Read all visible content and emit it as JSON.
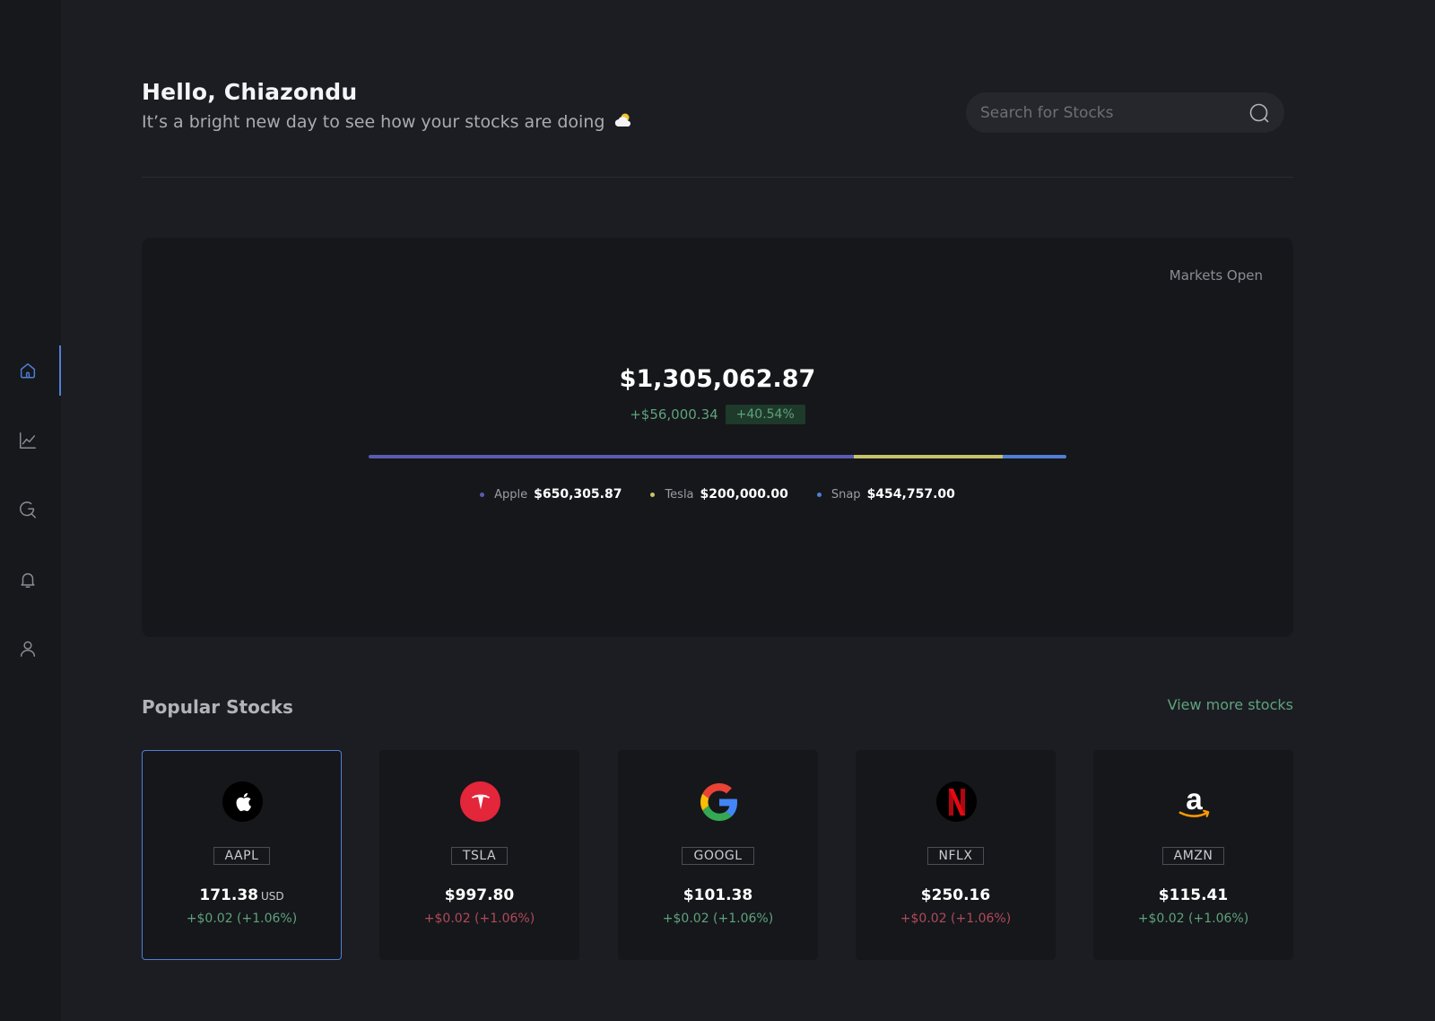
{
  "colors": {
    "accent": "#4f7fd6",
    "positive": "#5fa27d",
    "negative": "#b04a5a",
    "apple": "#5a5cb0",
    "tesla": "#c8c36a",
    "snap": "#4f7fd6"
  },
  "sidebar": {
    "items": [
      {
        "name": "home",
        "icon": "home-icon",
        "active": true
      },
      {
        "name": "charts",
        "icon": "line-chart-icon",
        "active": false
      },
      {
        "name": "explore",
        "icon": "refresh-search-icon",
        "active": false
      },
      {
        "name": "notifications",
        "icon": "bell-icon",
        "active": false
      },
      {
        "name": "profile",
        "icon": "user-icon",
        "active": false
      }
    ]
  },
  "header": {
    "greeting": "Hello, Chiazondu",
    "subtitle": "It’s a bright new day to see how your stocks are doing",
    "subtitle_icon": "cloud-sun-icon",
    "search_placeholder": "Search for Stocks"
  },
  "portfolio": {
    "market_status": "Markets Open",
    "total": "$1,305,062.87",
    "change_amount": "+$56,000.34",
    "change_pct": "+40.54%",
    "allocation": [
      {
        "name": "Apple",
        "value": "$650,305.87",
        "amount": 650305.87,
        "color": "#5a5cb0"
      },
      {
        "name": "Tesla",
        "value": "$200,000.00",
        "amount": 200000.0,
        "color": "#c8c36a"
      },
      {
        "name": "Snap",
        "value": "$454,757.00",
        "amount": 85000,
        "color": "#4f7fd6"
      }
    ]
  },
  "popular": {
    "title": "Popular Stocks",
    "view_more": "View more stocks",
    "stocks": [
      {
        "ticker": "AAPL",
        "price": "171.38",
        "currency": "USD",
        "change": "+$0.02 (+1.06%)",
        "direction": "up",
        "logo": "apple-logo-icon",
        "selected": true
      },
      {
        "ticker": "TSLA",
        "price": "$997.80",
        "currency": "",
        "change": "+$0.02 (+1.06%)",
        "direction": "down",
        "logo": "tesla-logo-icon",
        "selected": false
      },
      {
        "ticker": "GOOGL",
        "price": "$101.38",
        "currency": "",
        "change": "+$0.02 (+1.06%)",
        "direction": "up",
        "logo": "google-logo-icon",
        "selected": false
      },
      {
        "ticker": "NFLX",
        "price": "$250.16",
        "currency": "",
        "change": "+$0.02 (+1.06%)",
        "direction": "down",
        "logo": "netflix-logo-icon",
        "selected": false
      },
      {
        "ticker": "AMZN",
        "price": "$115.41",
        "currency": "",
        "change": "+$0.02 (+1.06%)",
        "direction": "up",
        "logo": "amazon-logo-icon",
        "selected": false
      }
    ]
  }
}
